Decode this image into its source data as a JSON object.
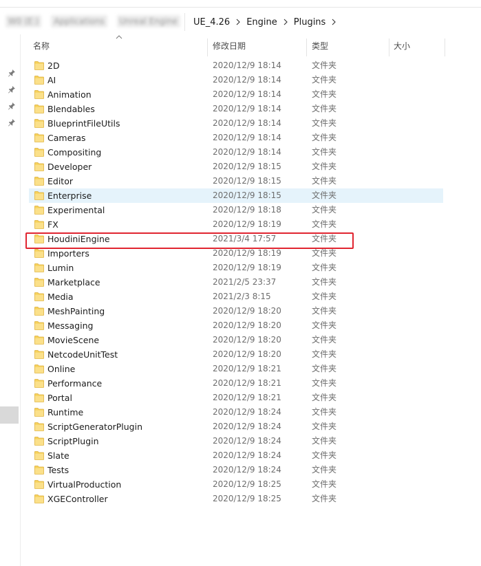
{
  "address_bar": {
    "blurred_crumbs": [
      "W0 (E:)",
      "Applications",
      "Unreal Engine"
    ],
    "crumbs": [
      "UE_4.26",
      "Engine",
      "Plugins"
    ]
  },
  "columns": {
    "name": "名称",
    "date": "修改日期",
    "type": "类型",
    "size": "大小"
  },
  "rows": [
    {
      "name": "2D",
      "date": "2020/12/9 18:14",
      "type": "文件夹"
    },
    {
      "name": "AI",
      "date": "2020/12/9 18:14",
      "type": "文件夹"
    },
    {
      "name": "Animation",
      "date": "2020/12/9 18:14",
      "type": "文件夹"
    },
    {
      "name": "Blendables",
      "date": "2020/12/9 18:14",
      "type": "文件夹"
    },
    {
      "name": "BlueprintFileUtils",
      "date": "2020/12/9 18:14",
      "type": "文件夹"
    },
    {
      "name": "Cameras",
      "date": "2020/12/9 18:14",
      "type": "文件夹"
    },
    {
      "name": "Compositing",
      "date": "2020/12/9 18:14",
      "type": "文件夹"
    },
    {
      "name": "Developer",
      "date": "2020/12/9 18:15",
      "type": "文件夹"
    },
    {
      "name": "Editor",
      "date": "2020/12/9 18:15",
      "type": "文件夹"
    },
    {
      "name": "Enterprise",
      "date": "2020/12/9 18:15",
      "type": "文件夹"
    },
    {
      "name": "Experimental",
      "date": "2020/12/9 18:18",
      "type": "文件夹"
    },
    {
      "name": "FX",
      "date": "2020/12/9 18:19",
      "type": "文件夹"
    },
    {
      "name": "HoudiniEngine",
      "date": "2021/3/4 17:57",
      "type": "文件夹"
    },
    {
      "name": "Importers",
      "date": "2020/12/9 18:19",
      "type": "文件夹"
    },
    {
      "name": "Lumin",
      "date": "2020/12/9 18:19",
      "type": "文件夹"
    },
    {
      "name": "Marketplace",
      "date": "2021/2/5 23:37",
      "type": "文件夹"
    },
    {
      "name": "Media",
      "date": "2021/2/3 8:15",
      "type": "文件夹"
    },
    {
      "name": "MeshPainting",
      "date": "2020/12/9 18:20",
      "type": "文件夹"
    },
    {
      "name": "Messaging",
      "date": "2020/12/9 18:20",
      "type": "文件夹"
    },
    {
      "name": "MovieScene",
      "date": "2020/12/9 18:20",
      "type": "文件夹"
    },
    {
      "name": "NetcodeUnitTest",
      "date": "2020/12/9 18:20",
      "type": "文件夹"
    },
    {
      "name": "Online",
      "date": "2020/12/9 18:21",
      "type": "文件夹"
    },
    {
      "name": "Performance",
      "date": "2020/12/9 18:21",
      "type": "文件夹"
    },
    {
      "name": "Portal",
      "date": "2020/12/9 18:21",
      "type": "文件夹"
    },
    {
      "name": "Runtime",
      "date": "2020/12/9 18:24",
      "type": "文件夹"
    },
    {
      "name": "ScriptGeneratorPlugin",
      "date": "2020/12/9 18:24",
      "type": "文件夹"
    },
    {
      "name": "ScriptPlugin",
      "date": "2020/12/9 18:24",
      "type": "文件夹"
    },
    {
      "name": "Slate",
      "date": "2020/12/9 18:24",
      "type": "文件夹"
    },
    {
      "name": "Tests",
      "date": "2020/12/9 18:24",
      "type": "文件夹"
    },
    {
      "name": "VirtualProduction",
      "date": "2020/12/9 18:25",
      "type": "文件夹"
    },
    {
      "name": "XGEController",
      "date": "2020/12/9 18:25",
      "type": "文件夹"
    }
  ],
  "hovered_row": "Enterprise",
  "highlighted_row": "HoudiniEngine",
  "colors": {
    "highlight_border": "#e0242f",
    "hover_background": "#e5f3fb",
    "folder_fill": "#f7d25c"
  },
  "icons": {
    "folder": "folder-icon",
    "pin": "pin-icon",
    "separator": "chevron-right-icon",
    "sort": "sort-up-icon"
  }
}
